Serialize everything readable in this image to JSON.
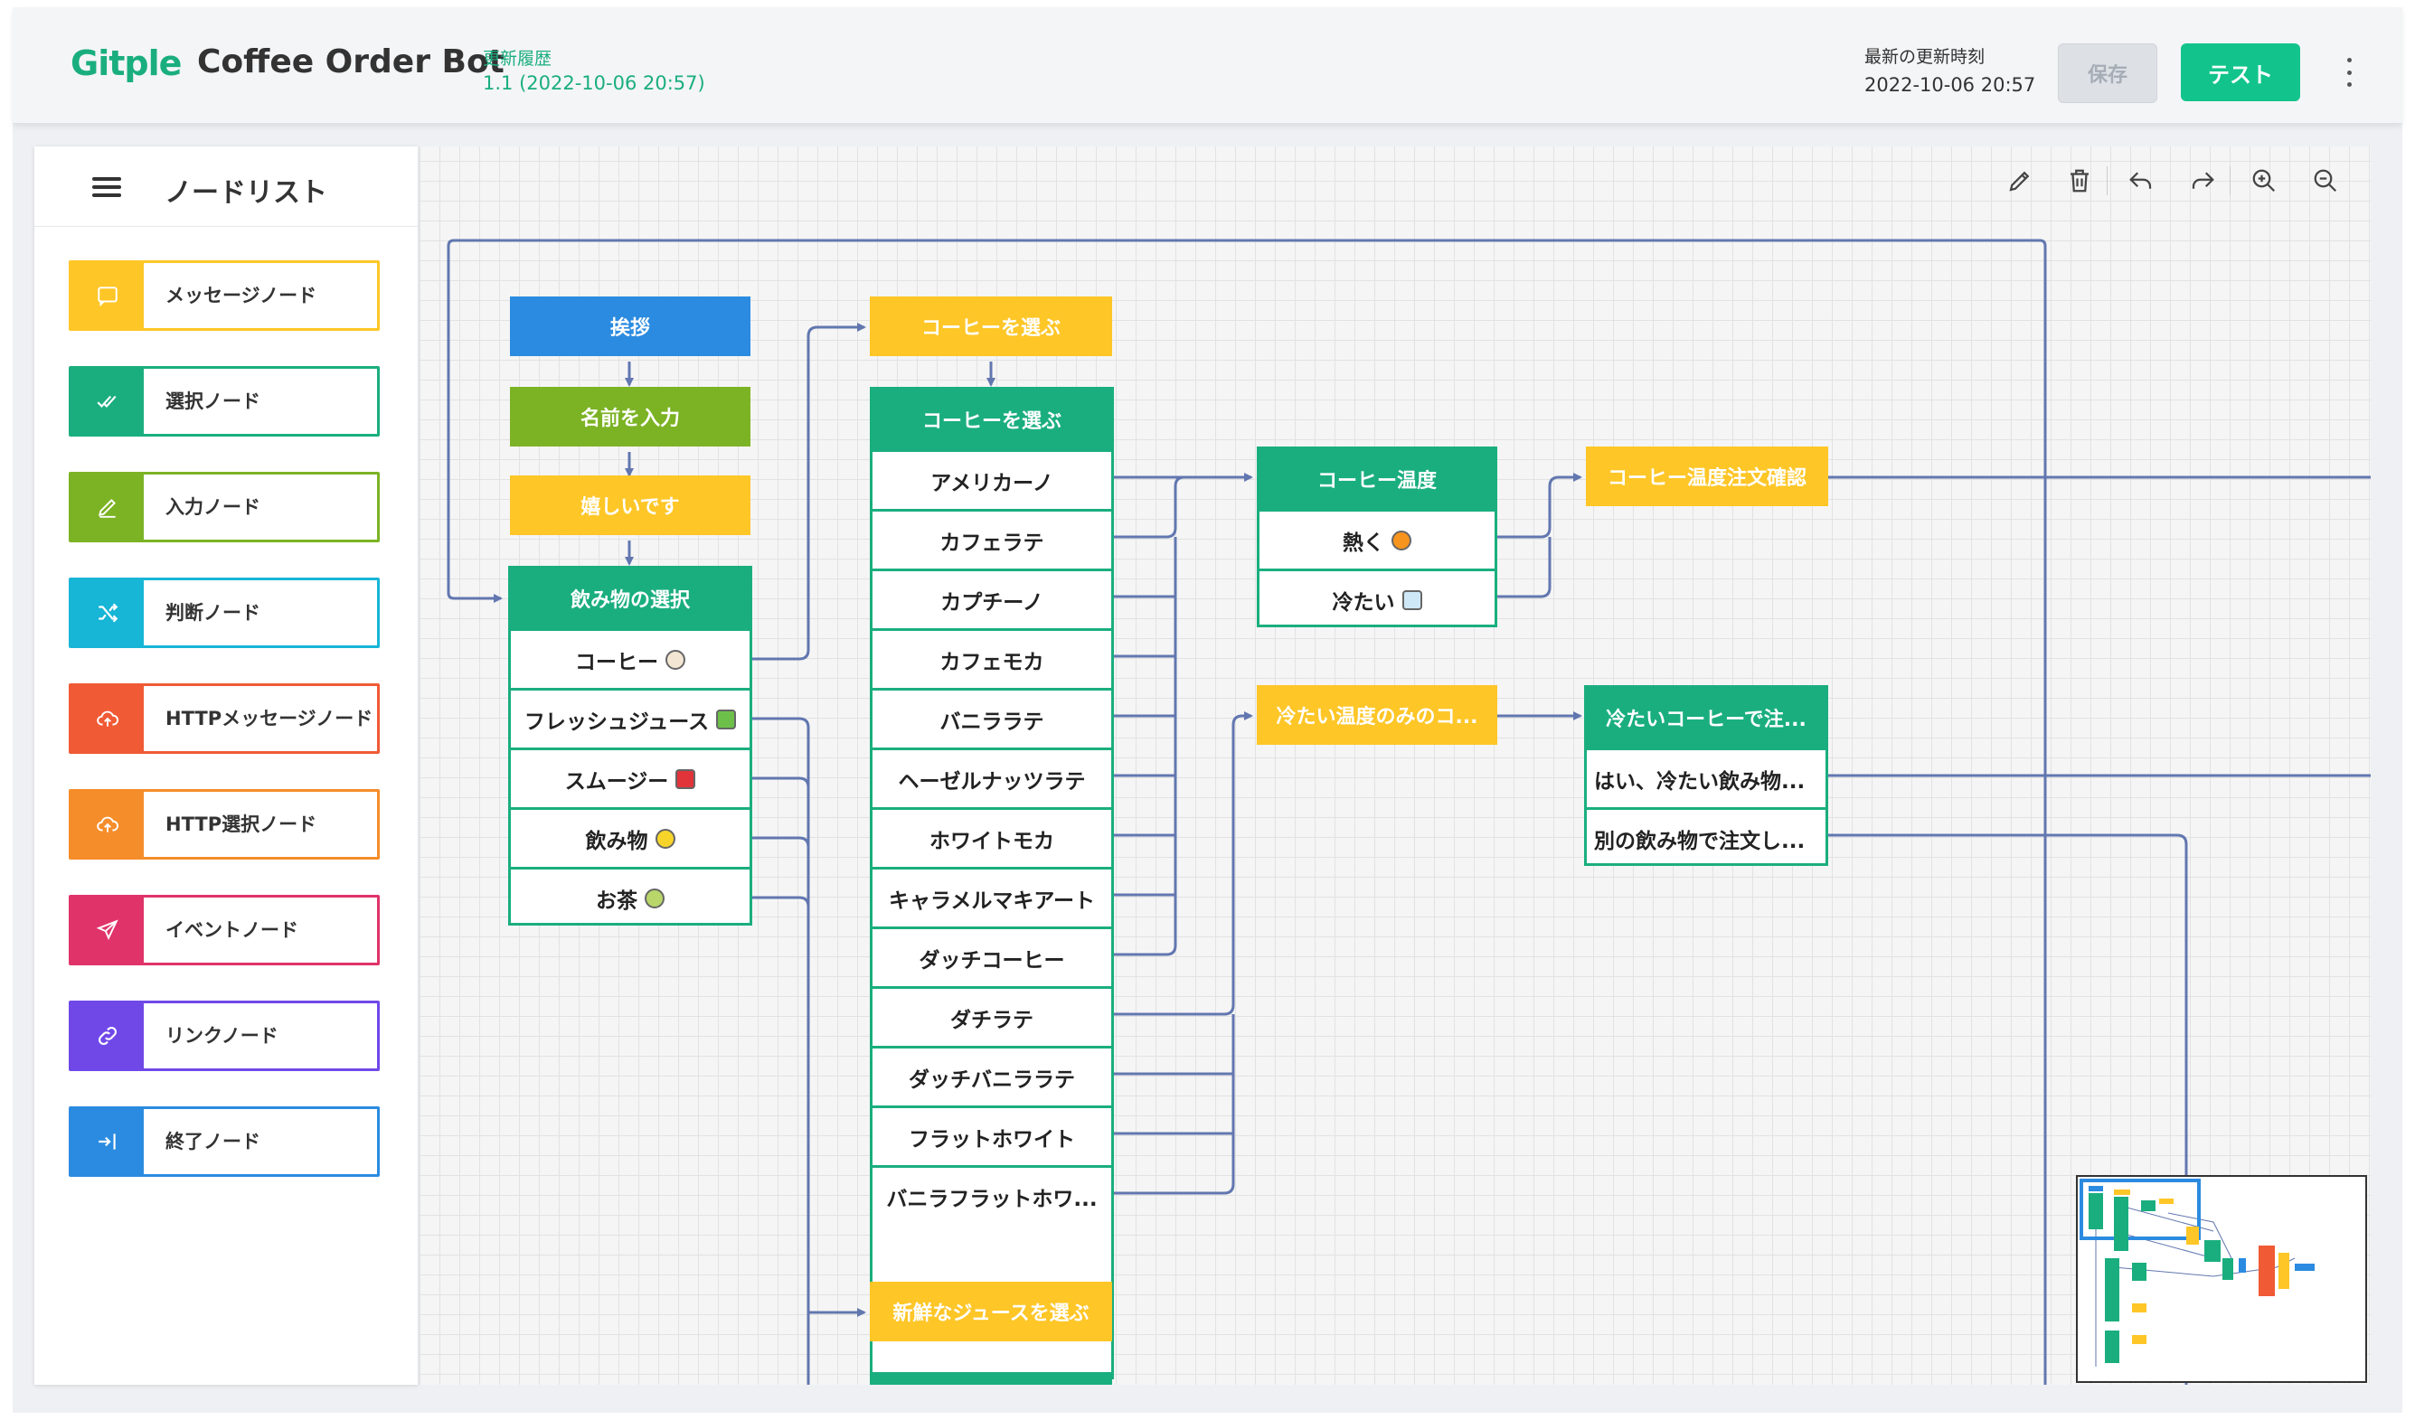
{
  "header": {
    "logo": "Gitple",
    "bot_name": "Coffee Order Bot",
    "history_label": "更新履歴",
    "version": "1.1 (2022-10-06 20:57)",
    "updated_label": "最新の更新時刻",
    "updated_time": "2022-10-06 20:57",
    "save_label": "保存",
    "test_label": "テスト"
  },
  "sidebar": {
    "title": "ノードリスト",
    "items": [
      {
        "label": "メッセージノード",
        "color": "#fec627",
        "icon": "message-icon"
      },
      {
        "label": "選択ノード",
        "color": "#1aae7e",
        "icon": "double-check-icon"
      },
      {
        "label": "入力ノード",
        "color": "#7cb325",
        "icon": "pencil-icon"
      },
      {
        "label": "判断ノード",
        "color": "#17b5d6",
        "icon": "shuffle-icon"
      },
      {
        "label": "HTTPメッセージノード",
        "color": "#f05a35",
        "icon": "cloud-upload-icon"
      },
      {
        "label": "HTTP選択ノード",
        "color": "#f58d2b",
        "icon": "cloud-upload-icon"
      },
      {
        "label": "イベントノード",
        "color": "#e0336a",
        "icon": "send-icon"
      },
      {
        "label": "リンクノード",
        "color": "#7048e8",
        "icon": "link-icon"
      },
      {
        "label": "終了ノード",
        "color": "#2b8be0",
        "icon": "exit-icon"
      }
    ]
  },
  "toolbar": {
    "icons": [
      "pencil-icon",
      "trash-icon",
      "undo-icon",
      "redo-icon",
      "zoom-in-icon",
      "zoom-out-icon"
    ]
  },
  "colors": {
    "message": "#fec627",
    "choice": "#1aae7e",
    "input": "#7cb325",
    "start": "#2b8be0",
    "edge": "#6277b0"
  },
  "flow": {
    "greeting": "挨拶",
    "enter_name": "名前を入力",
    "glad": "嬉しいです",
    "drink_choice": {
      "title": "飲み物の選択",
      "options": [
        {
          "label": "コーヒー",
          "emoji": "coffee-cup-icon"
        },
        {
          "label": "フレッシュジュース",
          "emoji": "juice-box-icon"
        },
        {
          "label": "スムージー",
          "emoji": "cup-with-straw-icon"
        },
        {
          "label": "飲み物",
          "emoji": "lemon-icon"
        },
        {
          "label": "お茶",
          "emoji": "tea-icon"
        }
      ]
    },
    "coffee_msg": "コーヒーを選ぶ",
    "coffee_choice": {
      "title": "コーヒーを選ぶ",
      "options": [
        "アメリカーノ",
        "カフェラテ",
        "カプチーノ",
        "カフェモカ",
        "バニララテ",
        "ヘーゼルナッツラテ",
        "ホワイトモカ",
        "キャラメルマキアート",
        "ダッチコーヒー",
        "ダチラテ",
        "ダッチバニララテ",
        "フラットホワイト",
        "バニラフラットホワ..."
      ]
    },
    "temp_choice": {
      "title": "コーヒー温度",
      "options": [
        {
          "label": "熱く",
          "emoji": "fire-icon"
        },
        {
          "label": "冷たい",
          "emoji": "ice-icon"
        }
      ]
    },
    "temp_confirm": "コーヒー温度注文確認",
    "cold_only": "冷たい温度のみのコ...",
    "cold_order": {
      "title": "冷たいコーヒーで注...",
      "options": [
        "はい、冷たい飲み物...",
        "別の飲み物で注文し..."
      ]
    },
    "juice_msg": "新鮮なジュースを選ぶ"
  }
}
